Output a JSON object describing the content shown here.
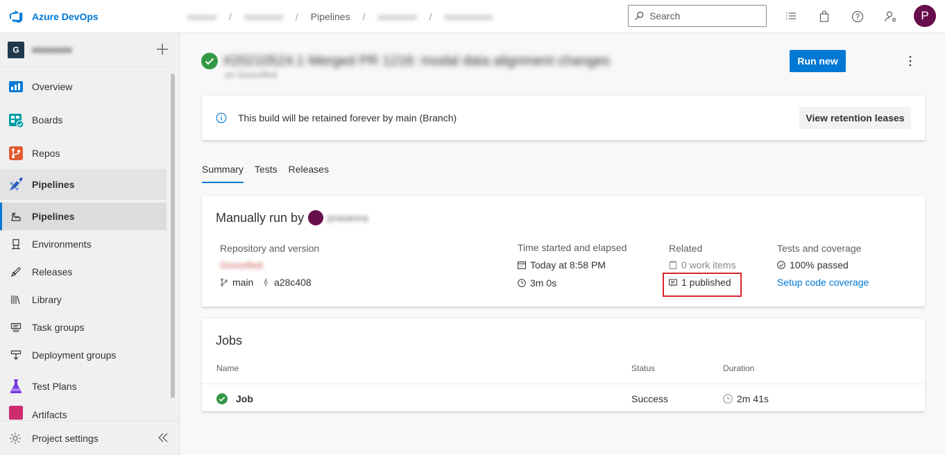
{
  "app": {
    "name": "Azure DevOps"
  },
  "breadcrumbs": [
    {
      "label": "",
      "blurred": true
    },
    {
      "label": "",
      "blurred": true
    },
    {
      "label": "Pipelines",
      "blurred": false
    },
    {
      "label": "",
      "blurred": true
    },
    {
      "label": "",
      "blurred": true
    }
  ],
  "search": {
    "placeholder": "Search"
  },
  "header_icons": [
    "task-list-icon",
    "shopping-bag-icon",
    "help-icon",
    "user-settings-icon"
  ],
  "user": {
    "initial": "P",
    "color": "#680d4b"
  },
  "sidebar": {
    "project": {
      "badge": "G",
      "name": ""
    },
    "items": [
      {
        "label": "Overview",
        "icon": "overview-icon"
      },
      {
        "label": "Boards",
        "icon": "boards-icon"
      },
      {
        "label": "Repos",
        "icon": "repos-icon"
      },
      {
        "label": "Pipelines",
        "icon": "pipelines-icon"
      },
      {
        "label": "Pipelines",
        "icon": "pipelines-sub-icon"
      },
      {
        "label": "Environments",
        "icon": "environments-icon"
      },
      {
        "label": "Releases",
        "icon": "releases-icon"
      },
      {
        "label": "Library",
        "icon": "library-icon"
      },
      {
        "label": "Task groups",
        "icon": "task-groups-icon"
      },
      {
        "label": "Deployment groups",
        "icon": "deployment-groups-icon"
      },
      {
        "label": "Test Plans",
        "icon": "test-plans-icon"
      },
      {
        "label": "Artifacts",
        "icon": "artifacts-icon"
      }
    ],
    "settings_label": "Project settings"
  },
  "run": {
    "title": "",
    "subtitle": "",
    "run_new_label": "Run new"
  },
  "banner": {
    "text": "This build will be retained forever by main (Branch)",
    "button_label": "View retention leases"
  },
  "tabs": [
    {
      "label": "Summary",
      "active": true
    },
    {
      "label": "Tests",
      "active": false
    },
    {
      "label": "Releases",
      "active": false
    }
  ],
  "summary": {
    "manual_run_by": "Manually run by",
    "user_name": "",
    "repo": {
      "label": "Repository and version",
      "repo_name": "",
      "branch": "main",
      "commit": "a28c408"
    },
    "time": {
      "label": "Time started and elapsed",
      "started": "Today at 8:58 PM",
      "elapsed": "3m 0s"
    },
    "related": {
      "label": "Related",
      "work_items": "0 work items",
      "published": "1 published"
    },
    "tests": {
      "label": "Tests and coverage",
      "passed": "100% passed",
      "coverage_link": "Setup code coverage"
    }
  },
  "jobs": {
    "title": "Jobs",
    "headers": {
      "name": "Name",
      "status": "Status",
      "duration": "Duration"
    },
    "rows": [
      {
        "name": "Job",
        "status": "Success",
        "duration": "2m 41s"
      }
    ]
  },
  "colors": {
    "accent": "#0078d4",
    "success": "#107c10",
    "highlight_border": "#d8242c"
  }
}
